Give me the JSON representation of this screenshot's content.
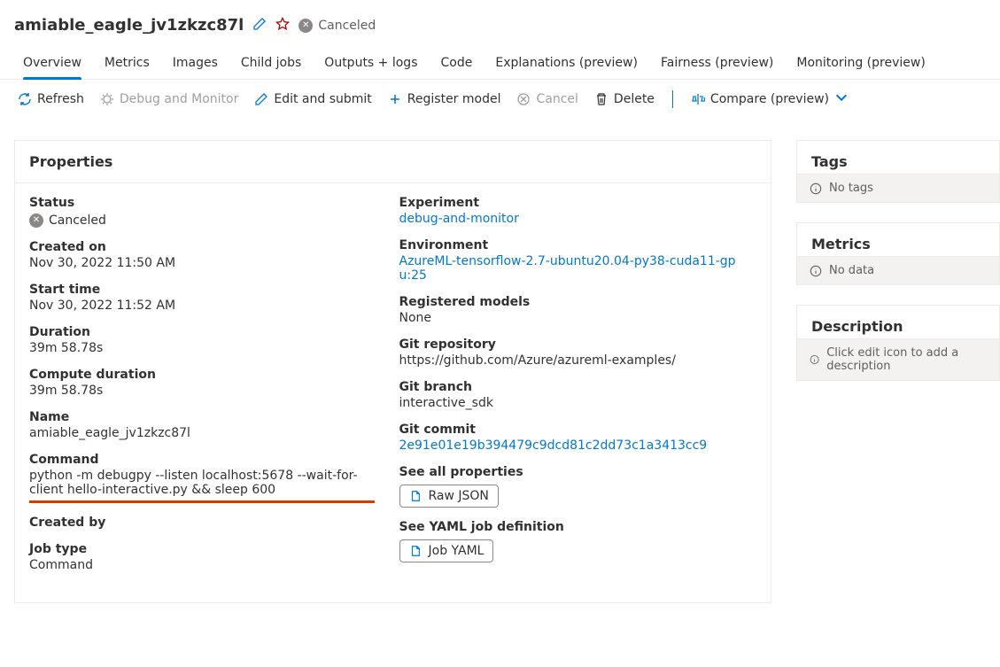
{
  "title": "amiable_eagle_jv1zkzc87l",
  "status_label": "Canceled",
  "tabs": [
    "Overview",
    "Metrics",
    "Images",
    "Child jobs",
    "Outputs + logs",
    "Code",
    "Explanations (preview)",
    "Fairness (preview)",
    "Monitoring (preview)"
  ],
  "toolbar": {
    "refresh": "Refresh",
    "debug": "Debug and Monitor",
    "edit": "Edit and submit",
    "register": "Register model",
    "cancel": "Cancel",
    "delete": "Delete",
    "compare": "Compare (preview)"
  },
  "properties_header": "Properties",
  "left": {
    "status_label": "Status",
    "status_value": "Canceled",
    "created_on_label": "Created on",
    "created_on_value": "Nov 30, 2022 11:50 AM",
    "start_time_label": "Start time",
    "start_time_value": "Nov 30, 2022 11:52 AM",
    "duration_label": "Duration",
    "duration_value": "39m 58.78s",
    "compute_duration_label": "Compute duration",
    "compute_duration_value": "39m 58.78s",
    "name_label": "Name",
    "name_value": "amiable_eagle_jv1zkzc87l",
    "command_label": "Command",
    "command_value": "python -m debugpy --listen localhost:5678 --wait-for-client hello-interactive.py && sleep 600",
    "created_by_label": "Created by",
    "created_by_value": "",
    "job_type_label": "Job type",
    "job_type_value": "Command"
  },
  "right": {
    "experiment_label": "Experiment",
    "experiment_value": "debug-and-monitor",
    "environment_label": "Environment",
    "environment_value": "AzureML-tensorflow-2.7-ubuntu20.04-py38-cuda11-gpu:25",
    "registered_models_label": "Registered models",
    "registered_models_value": "None",
    "git_repo_label": "Git repository",
    "git_repo_value": "https://github.com/Azure/azureml-examples/",
    "git_branch_label": "Git branch",
    "git_branch_value": "interactive_sdk",
    "git_commit_label": "Git commit",
    "git_commit_value": "2e91e01e19b394479c9dcd81c2dd73c1a3413cc9",
    "see_all_label": "See all properties",
    "raw_json": "Raw JSON",
    "see_yaml_label": "See YAML job definition",
    "job_yaml": "Job YAML"
  },
  "side": {
    "tags_header": "Tags",
    "tags_value": "No tags",
    "metrics_header": "Metrics",
    "metrics_value": "No data",
    "description_header": "Description",
    "description_value": "Click edit icon to add a description"
  }
}
